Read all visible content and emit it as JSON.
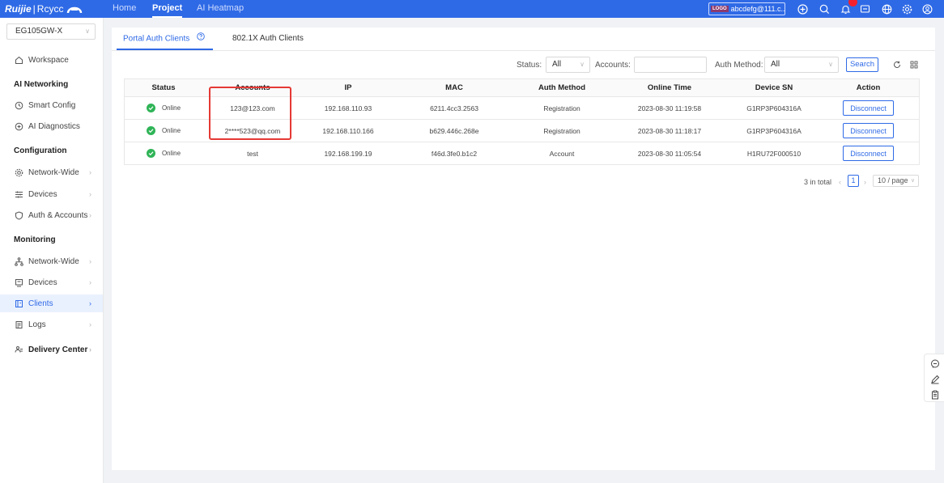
{
  "brand": {
    "primary": "Ruijie",
    "separator": "|",
    "secondary": "Rcycc"
  },
  "nav": [
    {
      "label": "Home",
      "active": false
    },
    {
      "label": "Project",
      "active": true
    },
    {
      "label": "AI Heatmap",
      "active": false
    }
  ],
  "account": {
    "logo_text": "LOGO",
    "name": "abcdefg@111.c..."
  },
  "notifications": {
    "badge": ""
  },
  "colors": {
    "primary": "#2f6ae6",
    "success": "#2fb457",
    "highlight": "#e53935",
    "active_bg": "#eaf1fe"
  },
  "sidebar": {
    "device": "EG105GW-X",
    "workspace": "Workspace",
    "groups": {
      "ai_networking": "AI Networking",
      "configuration": "Configuration",
      "monitoring": "Monitoring"
    },
    "items": {
      "smart_config": "Smart Config",
      "ai_diagnostics": "AI Diagnostics",
      "network_wide_config": "Network-Wide",
      "devices_config": "Devices",
      "auth_accounts": "Auth & Accounts",
      "network_wide_monitor": "Network-Wide",
      "devices_monitor": "Devices",
      "clients": "Clients",
      "logs": "Logs",
      "delivery_center": "Delivery Center"
    }
  },
  "tabs": [
    {
      "label": "Portal Auth Clients",
      "active": true
    },
    {
      "label": "802.1X Auth Clients",
      "active": false
    }
  ],
  "filters": {
    "status_label": "Status:",
    "status_value": "All",
    "accounts_label": "Accounts:",
    "accounts_value": "",
    "auth_method_label": "Auth Method:",
    "auth_method_value": "All",
    "search_label": "Search"
  },
  "table": {
    "columns": [
      "Status",
      "Accounts",
      "IP",
      "MAC",
      "Auth Method",
      "Online Time",
      "Device SN",
      "Action"
    ],
    "rows": [
      {
        "status": "Online",
        "account": "123@123.com",
        "ip": "192.168.110.93",
        "mac": "6211.4cc3.2563",
        "auth_method": "Registration",
        "online_time": "2023-08-30 11:19:58",
        "device_sn": "G1RP3P604316A",
        "action": "Disconnect"
      },
      {
        "status": "Online",
        "account": "2****523@qq.com",
        "ip": "192.168.110.166",
        "mac": "b629.446c.268e",
        "auth_method": "Registration",
        "online_time": "2023-08-30 11:18:17",
        "device_sn": "G1RP3P604316A",
        "action": "Disconnect"
      },
      {
        "status": "Online",
        "account": "test",
        "ip": "192.168.199.19",
        "mac": "f46d.3fe0.b1c2",
        "auth_method": "Account",
        "online_time": "2023-08-30 11:05:54",
        "device_sn": "H1RU72F000510",
        "action": "Disconnect"
      }
    ]
  },
  "pagination": {
    "total": "3 in total",
    "current": "1",
    "page_size": "10 / page"
  }
}
